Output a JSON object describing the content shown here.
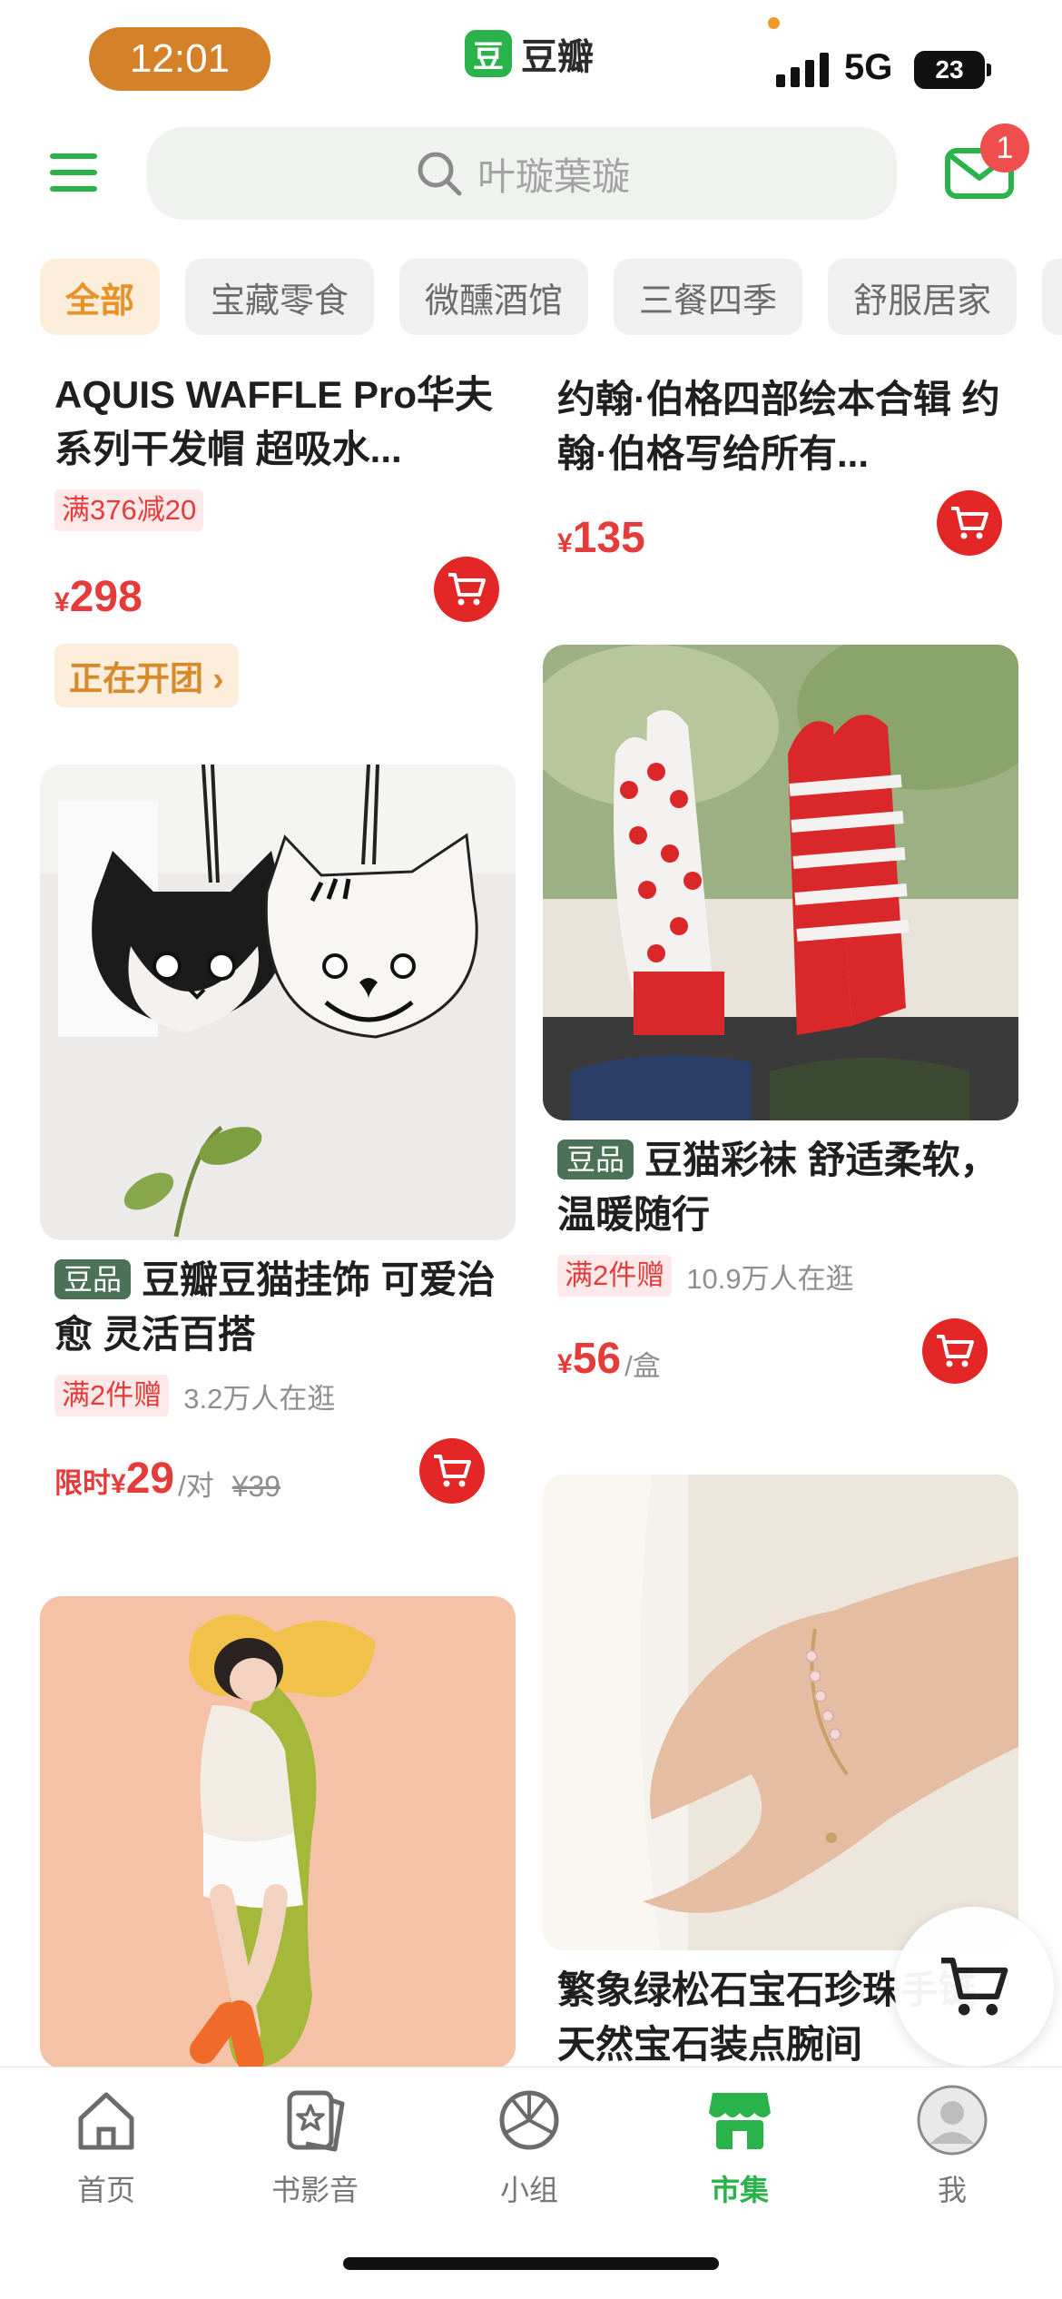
{
  "status_bar": {
    "time": "12:01",
    "network": "5G",
    "battery": "23"
  },
  "app": {
    "logo_char": "豆",
    "name": "豆瓣"
  },
  "header": {
    "search_placeholder": "叶璇葉璇",
    "mail_badge": "1"
  },
  "categories": [
    {
      "label": "全部",
      "active": true
    },
    {
      "label": "宝藏零食"
    },
    {
      "label": "微醺酒馆"
    },
    {
      "label": "三餐四季"
    },
    {
      "label": "舒服居家"
    }
  ],
  "products": [
    {
      "title": "AQUIS WAFFLE Pro华夫系列干发帽 超吸水...",
      "promo": "满376减20",
      "price_symbol": "¥",
      "price": "298",
      "action": "正在开团 ›"
    },
    {
      "title": "约翰·伯格四部绘本合辑 约翰·伯格写给所有...",
      "price_symbol": "¥",
      "price": "135"
    },
    {
      "tag": "豆品",
      "title": "豆瓣豆猫挂饰 可爱治愈 灵活百搭",
      "promo": "满2件赠",
      "browsing": "3.2万人在逛",
      "price_prefix": "限时",
      "price_symbol": "¥",
      "price": "29",
      "unit": "/对",
      "original_price": "¥39",
      "image": "cat-plush-charms"
    },
    {
      "tag": "豆品",
      "title": "豆猫彩袜 舒适柔软，温暖随行",
      "promo": "满2件赠",
      "browsing": "10.9万人在逛",
      "price_symbol": "¥",
      "price": "56",
      "unit": "/盒",
      "image": "striped-dotted-socks"
    },
    {
      "title": "",
      "image": "body-pillow"
    },
    {
      "title": "繁象绿松石宝石珍珠手链 天然宝石装点腕间",
      "image": "gemstone-bracelet"
    }
  ],
  "tabbar": [
    {
      "label": "首页",
      "icon": "home-icon"
    },
    {
      "label": "书影音",
      "icon": "book-movie-icon"
    },
    {
      "label": "小组",
      "icon": "group-icon"
    },
    {
      "label": "市集",
      "icon": "market-icon",
      "active": true
    },
    {
      "label": "我",
      "icon": "avatar-icon"
    }
  ],
  "colors": {
    "brand_green": "#2bb34b",
    "price_red": "#e53b3b",
    "orange": "#e8922a"
  }
}
